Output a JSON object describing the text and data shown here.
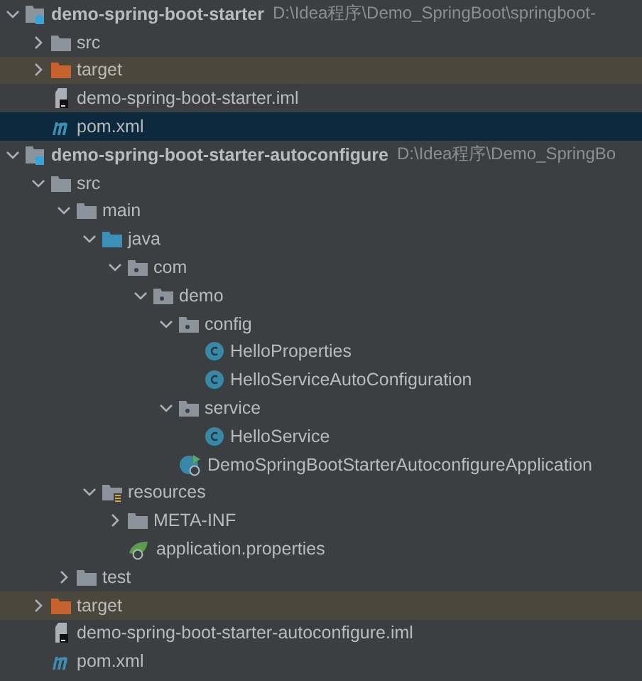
{
  "project_tree": [
    {
      "kind": "module",
      "name": "demo-spring-boot-starter",
      "path": "D:\\Idea程序\\Demo_SpringBoot\\springboot-",
      "expanded": true,
      "selected": false,
      "children": [
        {
          "kind": "folder",
          "name": "src",
          "expanded": false,
          "selected": false
        },
        {
          "kind": "excluded-folder",
          "name": "target",
          "expanded": false,
          "selected": false
        },
        {
          "kind": "iml",
          "name": "demo-spring-boot-starter.iml",
          "selected": false
        },
        {
          "kind": "maven",
          "name": "pom.xml",
          "selected": true
        }
      ]
    },
    {
      "kind": "module",
      "name": "demo-spring-boot-starter-autoconfigure",
      "path": "D:\\Idea程序\\Demo_SpringBo",
      "expanded": true,
      "selected": false,
      "children": [
        {
          "kind": "folder",
          "name": "src",
          "expanded": true,
          "selected": false,
          "children": [
            {
              "kind": "folder",
              "name": "main",
              "expanded": true,
              "selected": false,
              "children": [
                {
                  "kind": "source-folder",
                  "name": "java",
                  "expanded": true,
                  "selected": false,
                  "children": [
                    {
                      "kind": "package",
                      "name": "com",
                      "expanded": true,
                      "selected": false,
                      "children": [
                        {
                          "kind": "package",
                          "name": "demo",
                          "expanded": true,
                          "selected": false,
                          "children": [
                            {
                              "kind": "package",
                              "name": "config",
                              "expanded": true,
                              "selected": false,
                              "children": [
                                {
                                  "kind": "class",
                                  "name": "HelloProperties",
                                  "selected": false
                                },
                                {
                                  "kind": "class",
                                  "name": "HelloServiceAutoConfiguration",
                                  "selected": false
                                }
                              ]
                            },
                            {
                              "kind": "package",
                              "name": "service",
                              "expanded": true,
                              "selected": false,
                              "children": [
                                {
                                  "kind": "class",
                                  "name": "HelloService",
                                  "selected": false
                                }
                              ]
                            },
                            {
                              "kind": "app-class",
                              "name": "DemoSpringBootStarterAutoconfigureApplication",
                              "selected": false
                            }
                          ]
                        }
                      ]
                    }
                  ]
                },
                {
                  "kind": "resources-folder",
                  "name": "resources",
                  "expanded": true,
                  "selected": false,
                  "children": [
                    {
                      "kind": "folder",
                      "name": "META-INF",
                      "expanded": false,
                      "selected": false
                    },
                    {
                      "kind": "spring-properties",
                      "name": "application.properties",
                      "selected": false
                    }
                  ]
                }
              ]
            },
            {
              "kind": "folder",
              "name": "test",
              "expanded": false,
              "selected": false
            }
          ]
        },
        {
          "kind": "excluded-folder",
          "name": "target",
          "expanded": false,
          "selected": false
        },
        {
          "kind": "iml",
          "name": "demo-spring-boot-starter-autoconfigure.iml",
          "selected": false
        },
        {
          "kind": "maven",
          "name": "pom.xml",
          "selected": false
        }
      ]
    }
  ]
}
